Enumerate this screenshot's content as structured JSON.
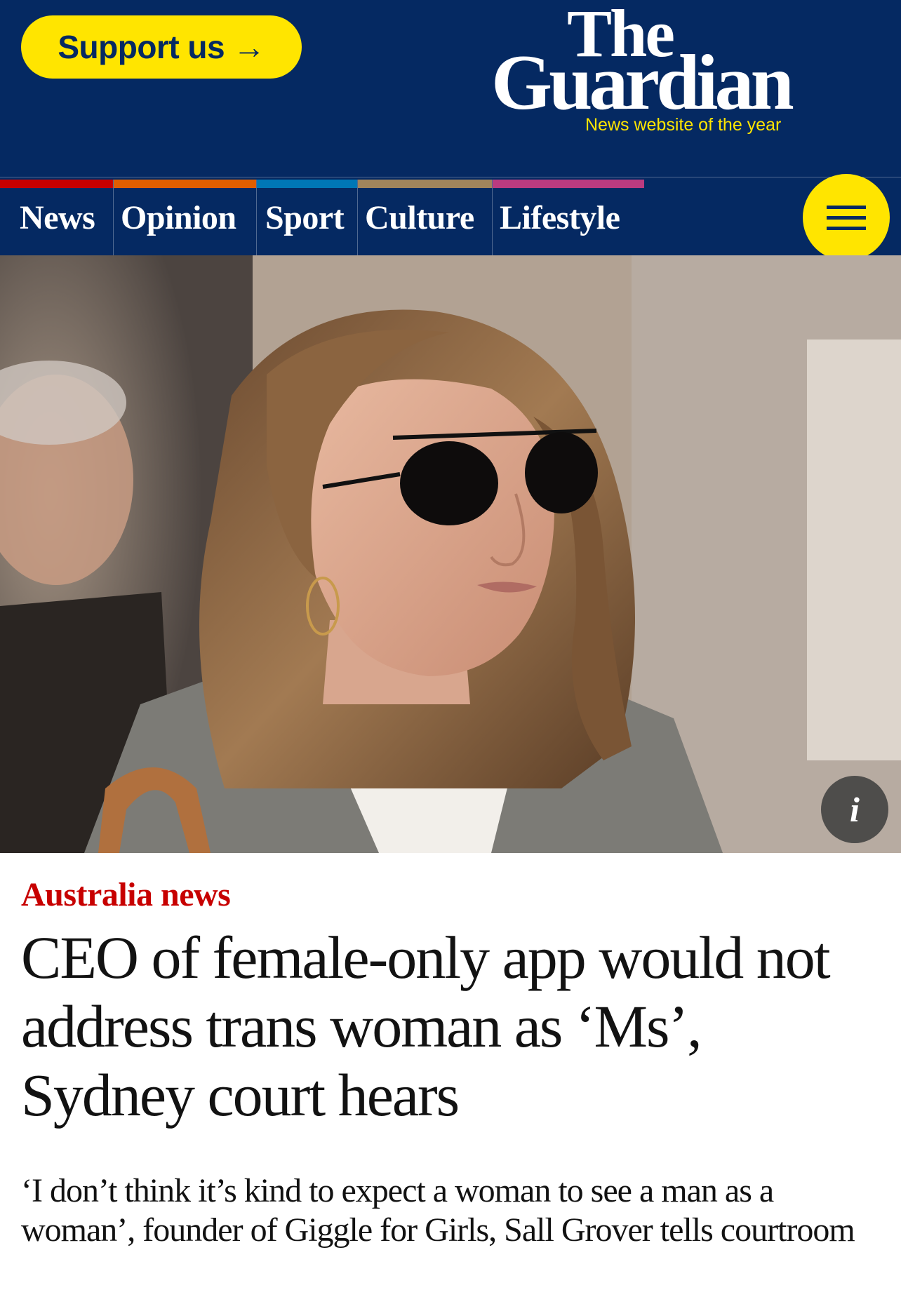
{
  "header": {
    "support_label": "Support us",
    "support_arrow": "→",
    "logo_line1": "The",
    "logo_line2": "Guardian",
    "tagline": "News website of the year",
    "colors": {
      "background": "#052962",
      "accent": "#ffe500"
    }
  },
  "nav": {
    "items": [
      {
        "label": "News",
        "color": "#c70000"
      },
      {
        "label": "Opinion",
        "color": "#e05e00"
      },
      {
        "label": "Sport",
        "color": "#0077b6"
      },
      {
        "label": "Culture",
        "color": "#a1845c"
      },
      {
        "label": "Lifestyle",
        "color": "#bb3b80"
      }
    ],
    "menu_icon": "hamburger-icon"
  },
  "photo": {
    "info_label": "i"
  },
  "article": {
    "kicker": "Australia news",
    "headline": "CEO of female-only app would not address trans woman as ‘Ms’, Sydney court hears",
    "standfirst": "‘I don’t think it’s kind to expect a woman to see a man as a woman’, founder of Giggle for Girls, Sall Grover tells courtroom",
    "kicker_color": "#c70000"
  }
}
